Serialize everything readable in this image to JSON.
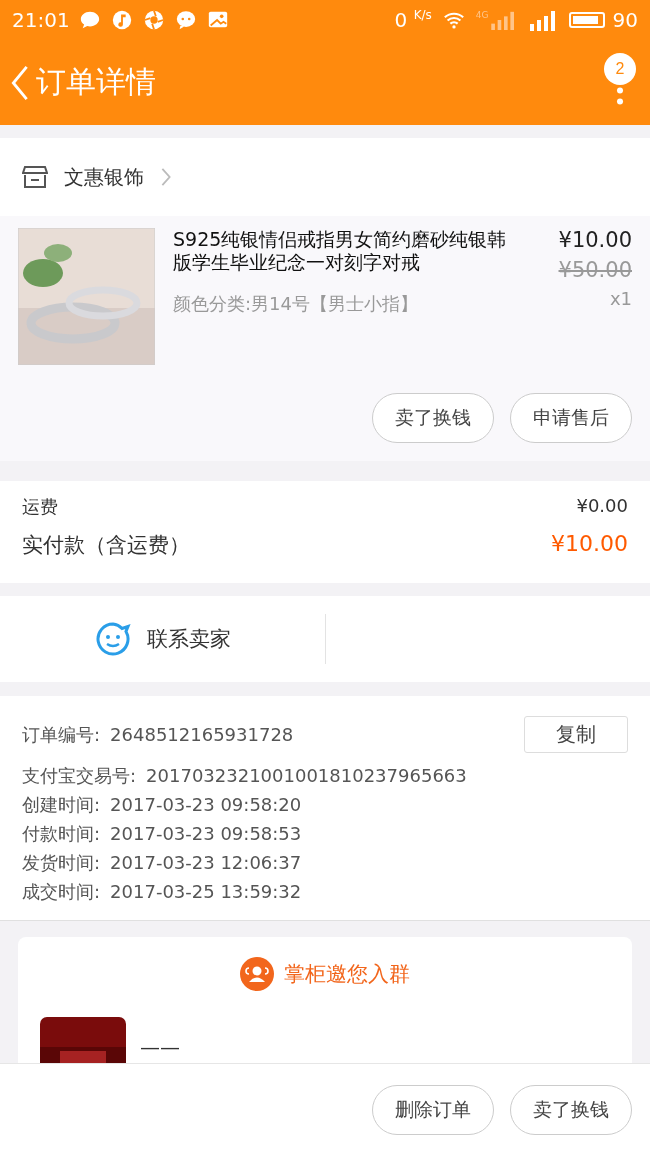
{
  "status_bar": {
    "time": "21:01",
    "net_speed": "0",
    "net_unit": "K/s",
    "network": "4G",
    "battery": "90"
  },
  "header": {
    "title": "订单详情",
    "badge": "2"
  },
  "shop": {
    "name": "文惠银饰"
  },
  "product": {
    "title": "S925纯银情侣戒指男女简约磨砂纯银韩版学生毕业纪念一对刻字对戒",
    "variant": "颜色分类:男14号【男士小指】",
    "price": "¥10.00",
    "original_price": "¥50.00",
    "quantity": "x1",
    "kind": "picture",
    "actions": [
      "卖了换钱",
      "申请售后"
    ]
  },
  "fees": [
    {
      "label": "运费",
      "value": "¥0.00",
      "kind": "plain"
    },
    {
      "label": "实付款（含运费）",
      "value": "¥10.00",
      "kind": "total"
    }
  ],
  "contact": {
    "label": "联系卖家"
  },
  "order_info": {
    "copy_button": "复制",
    "rows": [
      {
        "label": "订单编号:",
        "value": "2648512165931728"
      },
      {
        "label": "支付宝交易号:",
        "value": "2017032321001001810237965663"
      },
      {
        "label": "创建时间:",
        "value": "2017-03-23 09:58:20"
      },
      {
        "label": "付款时间:",
        "value": "2017-03-23 09:58:53"
      },
      {
        "label": "发货时间:",
        "value": "2017-03-23 12:06:37"
      },
      {
        "label": "成交时间:",
        "value": "2017-03-25 13:59:32"
      }
    ]
  },
  "group_card": {
    "title": "掌柜邀您入群",
    "group_name": "——"
  },
  "bottom_actions": [
    "删除订单",
    "卖了换钱"
  ]
}
